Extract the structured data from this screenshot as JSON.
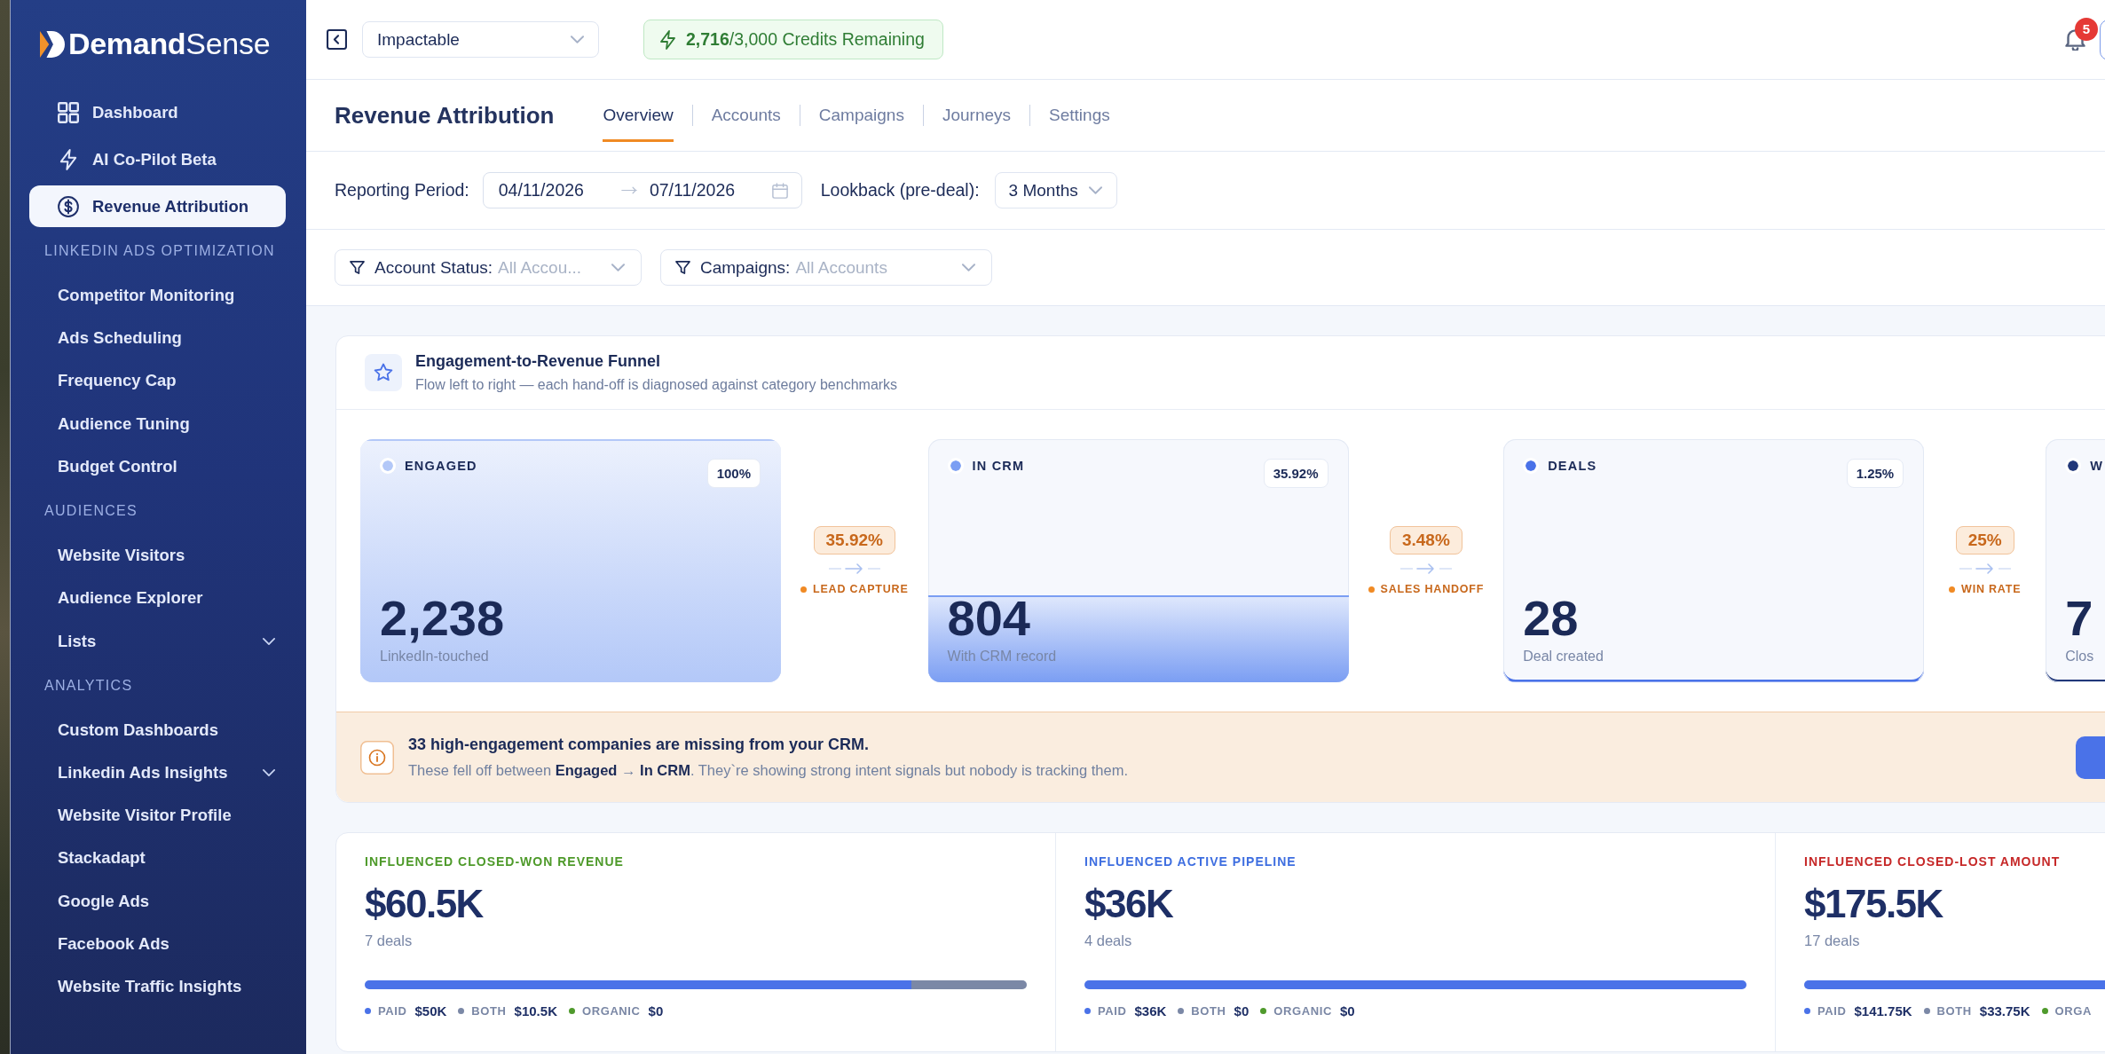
{
  "sidebar": {
    "logo": "**Demand**Sense",
    "main_items": [
      {
        "label": "Dashboard",
        "selected": false
      },
      {
        "label": "AI Co-Pilot Beta",
        "selected": false
      },
      {
        "label": "Revenue Attribution",
        "selected": true
      }
    ],
    "sections": [
      {
        "title": "LINKEDIN ADS OPTIMIZATION",
        "items": [
          {
            "kind": "link",
            "label": "Competitor Monitoring",
            "selected": false
          },
          {
            "kind": "link",
            "label": "Ads Scheduling",
            "selected": false
          },
          {
            "kind": "link",
            "label": "Frequency Cap",
            "selected": false
          },
          {
            "kind": "link",
            "label": "Audience Tuning",
            "selected": false
          },
          {
            "kind": "link",
            "label": "Budget Control",
            "selected": false
          }
        ]
      },
      {
        "title": "AUDIENCES",
        "items": [
          {
            "kind": "link",
            "label": "Website Visitors",
            "selected": false
          },
          {
            "kind": "link",
            "label": "Audience Explorer",
            "selected": false
          },
          {
            "kind": "group",
            "label": "Lists",
            "selected": false,
            "expanded": false
          }
        ]
      },
      {
        "title": "ANALYTICS",
        "items": [
          {
            "kind": "link",
            "label": "Custom Dashboards",
            "selected": false
          },
          {
            "kind": "group",
            "label": "Linkedin Ads Insights",
            "selected": false,
            "expanded": false
          },
          {
            "kind": "link",
            "label": "Website Visitor Profile",
            "selected": false
          },
          {
            "kind": "link",
            "label": "Stackadapt",
            "selected": false
          },
          {
            "kind": "link",
            "label": "Google Ads",
            "selected": false
          },
          {
            "kind": "link",
            "label": "Facebook Ads",
            "selected": false
          },
          {
            "kind": "link",
            "label": "Website Traffic Insights",
            "selected": false
          }
        ]
      }
    ]
  },
  "top_bar": {
    "workspace": "Impactable",
    "credits": "**2,716**/3,000 Credits Remaining",
    "notification_count": "5"
  },
  "header": {
    "title": "Revenue Attribution",
    "tabs": [
      {
        "label": "Overview",
        "selected": true
      },
      {
        "label": "Accounts",
        "selected": false
      },
      {
        "label": "Campaigns",
        "selected": false
      },
      {
        "label": "Journeys",
        "selected": false
      },
      {
        "label": "Settings",
        "selected": false
      }
    ]
  },
  "period": {
    "label": "Reporting Period:",
    "start_date": "04/11/2026",
    "end_date": "07/11/2026",
    "lookback_label": "Lookback (pre-deal):",
    "lookback": "3 Months"
  },
  "filters": [
    {
      "label": "Account Status:",
      "value": "All Accou..."
    },
    {
      "label": "Campaigns:",
      "value": "All Accounts"
    }
  ],
  "funnel": {
    "title": "Engagement-to-Revenue Funnel",
    "subtitle": "Flow left to right — each hand-off is diagnosed against category benchmarks",
    "stages": [
      {
        "label": "ENGAGED",
        "share": "100%",
        "count": "2,238",
        "caption": "LinkedIn-touched",
        "color": "#b3c8f8"
      },
      {
        "label": "IN CRM",
        "share": "35.92%",
        "count": "804",
        "caption": "With CRM record",
        "color": "#7b9ef3"
      },
      {
        "label": "DEALS",
        "share": "1.25%",
        "count": "28",
        "caption": "Deal created",
        "color": "#4a72e8"
      },
      {
        "label": "W",
        "count": "7",
        "caption": "Clos",
        "color": "#22387a"
      }
    ],
    "transitions": [
      {
        "rate": "35.92%",
        "label": "LEAD CAPTURE"
      },
      {
        "rate": "3.48%",
        "label": "SALES HANDOFF"
      },
      {
        "rate": "25%",
        "label": "WIN RATE"
      }
    ],
    "alert": {
      "title": "33 high-engagement companies are missing from your CRM.",
      "message": "These fell off between **Engaged** → **In CRM**. They`re showing strong intent signals but nobody is tracking them."
    }
  },
  "metrics": [
    {
      "label": "INFLUENCED CLOSED-WON REVENUE",
      "color": "#4e9a2a",
      "value": "$60.5K",
      "deals": "7 deals",
      "breakdown": [
        {
          "label": "PAID",
          "amount": "$50K",
          "level": 0.8264,
          "color": "#4a72e8"
        },
        {
          "label": "BOTH",
          "amount": "$10.5K",
          "level": 0.1736,
          "color": "#7b88a6"
        },
        {
          "label": "ORGANIC",
          "amount": "$0",
          "color": "#4f9a2c"
        }
      ]
    },
    {
      "label": "INFLUENCED ACTIVE PIPELINE",
      "color": "#3e6ee0",
      "value": "$36K",
      "deals": "4 deals",
      "breakdown": [
        {
          "label": "PAID",
          "amount": "$36K",
          "level": 1,
          "color": "#4a72e8"
        },
        {
          "label": "BOTH",
          "amount": "$0",
          "color": "#7b88a6"
        },
        {
          "label": "ORGANIC",
          "amount": "$0",
          "color": "#4f9a2c"
        }
      ]
    },
    {
      "label": "INFLUENCED CLOSED-LOST AMOUNT",
      "color": "#c62828",
      "value": "$175.5K",
      "deals": "17 deals",
      "breakdown": [
        {
          "label": "PAID",
          "amount": "$141.75K",
          "level": 0.8077,
          "color": "#4a72e8"
        },
        {
          "label": "BOTH",
          "amount": "$33.75K",
          "color": "#7b88a6"
        },
        {
          "label": "ORGA",
          "color": "#4f9a2c"
        }
      ]
    }
  ]
}
